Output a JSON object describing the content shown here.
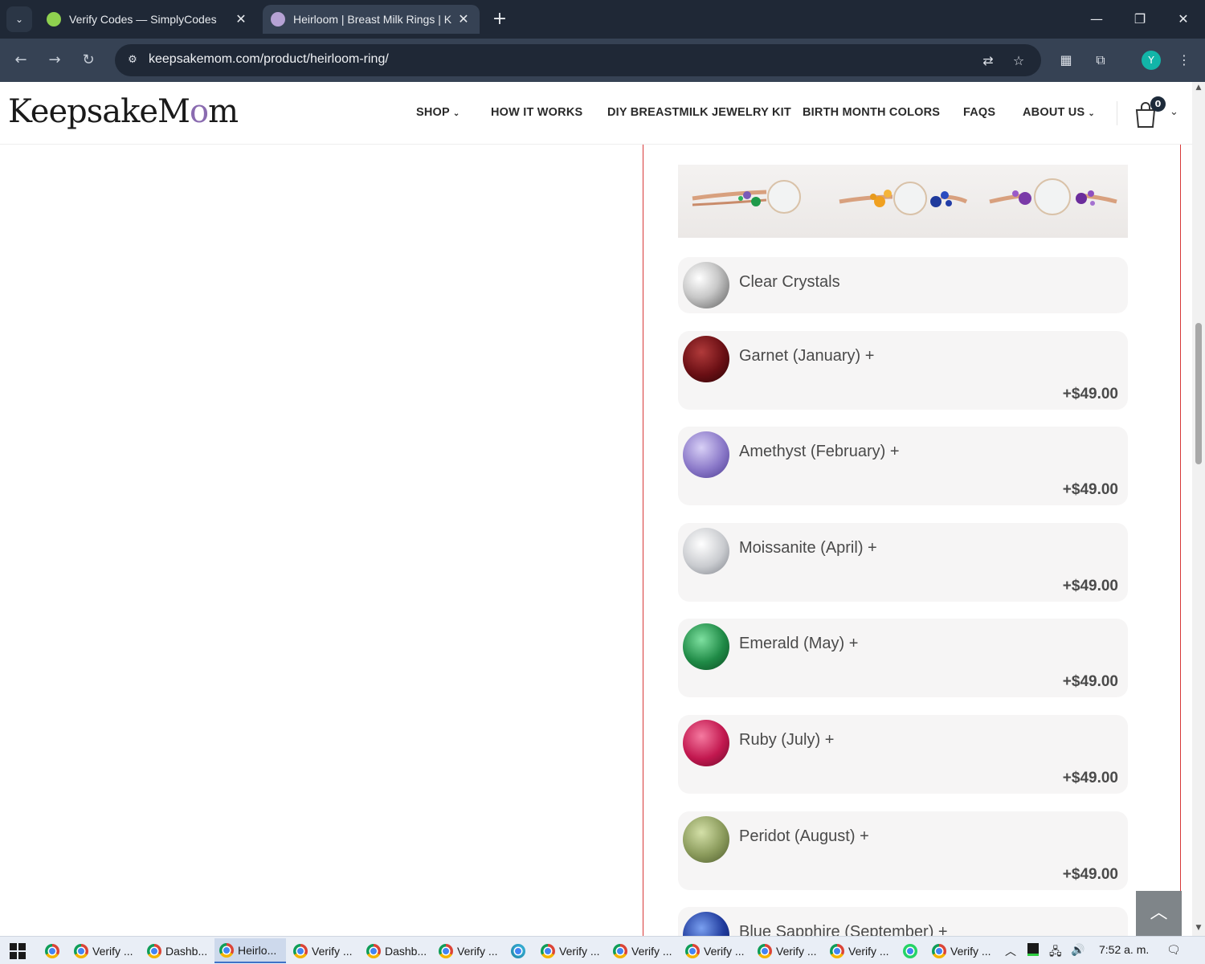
{
  "browser": {
    "tabs": [
      {
        "title": "Verify Codes — SimplyCodes",
        "active": false
      },
      {
        "title": "Heirloom | Breast Milk Rings | K",
        "active": true
      }
    ],
    "url": "keepsakemom.com/product/heirloom-ring/",
    "profile_initial": "Y"
  },
  "site": {
    "logo": {
      "part1": "Keepsake",
      "part2": "M",
      "part3": "o",
      "part4": "m"
    },
    "nav": [
      {
        "label": "SHOP",
        "dropdown": true
      },
      {
        "label": "HOW IT WORKS",
        "dropdown": false
      },
      {
        "label": "DIY BREASTMILK JEWELRY KIT",
        "dropdown": false
      },
      {
        "label": "BIRTH MONTH COLORS",
        "dropdown": false
      },
      {
        "label": "FAQS",
        "dropdown": false
      },
      {
        "label": "ABOUT US",
        "dropdown": true
      }
    ],
    "cart_count": "0"
  },
  "options": [
    {
      "label": "Clear Crystals",
      "price": "",
      "color": "#b8b8b8"
    },
    {
      "label": "Garnet (January) +",
      "price": "+$49.00",
      "color": "#6a0f14"
    },
    {
      "label": "Amethyst (February) +",
      "price": "+$49.00",
      "color": "#8a78c8"
    },
    {
      "label": "Moissanite (April) +",
      "price": "+$49.00",
      "color": "#c9cbcf"
    },
    {
      "label": "Emerald (May) +",
      "price": "+$49.00",
      "color": "#1f8a46"
    },
    {
      "label": "Ruby (July) +",
      "price": "+$49.00",
      "color": "#c2184f"
    },
    {
      "label": "Peridot (August) +",
      "price": "+$49.00",
      "color": "#8a9a5b"
    },
    {
      "label": "Blue Sapphire (September) +",
      "price": "",
      "color": "#1f3a9c"
    }
  ],
  "taskbar": {
    "apps": [
      "Verify ...",
      "Dashb...",
      "Heirlo...",
      "Verify ...",
      "Dashb...",
      "Verify ...",
      "Verify ...",
      "Verify ...",
      "Verify ...",
      "Verify ...",
      "Verify ...",
      "Verify ..."
    ],
    "time": "7:52 a. m."
  }
}
